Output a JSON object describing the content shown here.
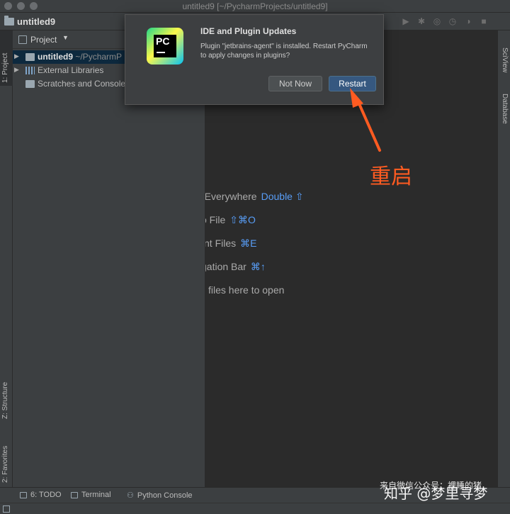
{
  "window": {
    "title": "untitled9 [~/PycharmProjects/untitled9]"
  },
  "navbar": {
    "project": "untitled9"
  },
  "left_strip": {
    "project_tab": "1: Project",
    "structure_tab": "Z: Structure",
    "favorites_tab": "2: Favorites"
  },
  "right_strip": {
    "sciview_tab": "SciView",
    "database_tab": "Database"
  },
  "project_panel": {
    "header": "Project",
    "tree": [
      {
        "name": "untitled9",
        "path": "~/PycharmP",
        "icon": "folder-icon"
      },
      {
        "name": "External Libraries",
        "icon": "library-icon"
      },
      {
        "name": "Scratches and Consoles",
        "icon": "scratches-icon"
      }
    ]
  },
  "editor_hints": [
    {
      "text": "ch Everywhere",
      "key": "Double ⇧"
    },
    {
      "text": "o File",
      "key": "⇧⌘O"
    },
    {
      "text": "nt Files",
      "key": "⌘E"
    },
    {
      "text": "gation Bar",
      "key": "⌘↑"
    },
    {
      "text": "files here to open",
      "key": ""
    }
  ],
  "popup": {
    "title": "IDE and Plugin Updates",
    "message": "Plugin \"jetbrains-agent\" is installed. Restart PyCharm to apply changes in plugins?",
    "not_now": "Not Now",
    "restart": "Restart",
    "logo_text": "PC"
  },
  "annotation": {
    "text": "重启",
    "color": "#ff5b21"
  },
  "bottom_tabs": {
    "todo": "6: TODO",
    "terminal": "Terminal",
    "python_console": "Python Console"
  },
  "watermark": {
    "source": "来自微信公众号：裸睡的猪",
    "brand": "知乎 @梦里寻梦"
  }
}
